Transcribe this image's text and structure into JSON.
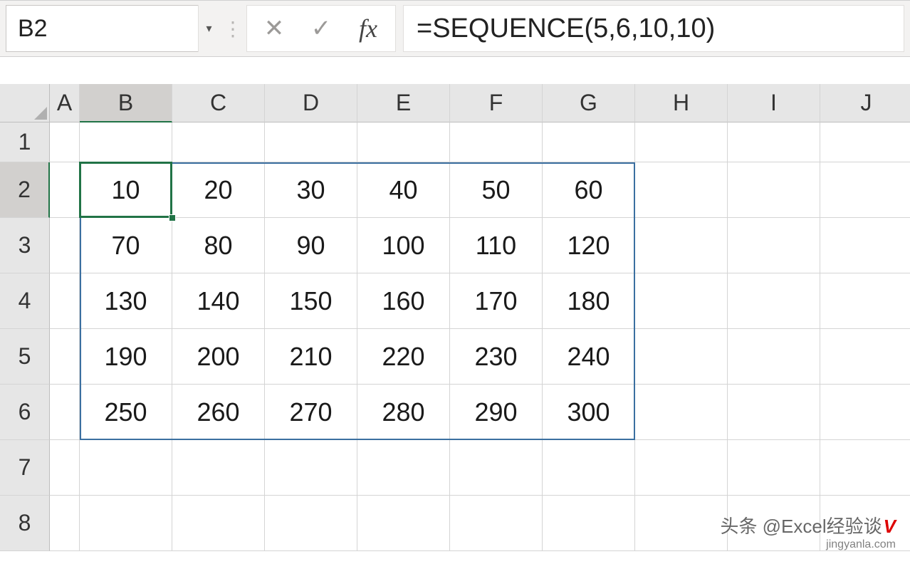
{
  "formula_bar": {
    "cell_ref": "B2",
    "formula": "=SEQUENCE(5,6,10,10)",
    "fx_label": "fx",
    "cancel_symbol": "✕",
    "enter_symbol": "✓"
  },
  "grid": {
    "columns": [
      "A",
      "B",
      "C",
      "D",
      "E",
      "F",
      "G",
      "H",
      "I",
      "J"
    ],
    "rows": [
      "1",
      "2",
      "3",
      "4",
      "5",
      "6",
      "7",
      "8"
    ],
    "active_col": "B",
    "active_row": "2",
    "spill_range": {
      "c1": "B",
      "r1": "2",
      "c2": "G",
      "r2": "6"
    },
    "data": [
      [
        "10",
        "20",
        "30",
        "40",
        "50",
        "60"
      ],
      [
        "70",
        "80",
        "90",
        "100",
        "110",
        "120"
      ],
      [
        "130",
        "140",
        "150",
        "160",
        "170",
        "180"
      ],
      [
        "190",
        "200",
        "210",
        "220",
        "230",
        "240"
      ],
      [
        "250",
        "260",
        "270",
        "280",
        "290",
        "300"
      ]
    ]
  },
  "watermark": {
    "line1_prefix": "头条 @Excel",
    "line1_suffix": "经验谈",
    "v": "V",
    "line2": "jingyanla.com"
  },
  "chart_data": {
    "type": "table",
    "title": "SEQUENCE(5,6,10,10) spill output",
    "columns": [
      "B",
      "C",
      "D",
      "E",
      "F",
      "G"
    ],
    "rows": [
      "2",
      "3",
      "4",
      "5",
      "6"
    ],
    "values": [
      [
        10,
        20,
        30,
        40,
        50,
        60
      ],
      [
        70,
        80,
        90,
        100,
        110,
        120
      ],
      [
        130,
        140,
        150,
        160,
        170,
        180
      ],
      [
        190,
        200,
        210,
        220,
        230,
        240
      ],
      [
        250,
        260,
        270,
        280,
        290,
        300
      ]
    ]
  },
  "colors": {
    "accent": "#217346",
    "spill_border": "#3b6fa0",
    "header_bg": "#e6e6e6"
  }
}
